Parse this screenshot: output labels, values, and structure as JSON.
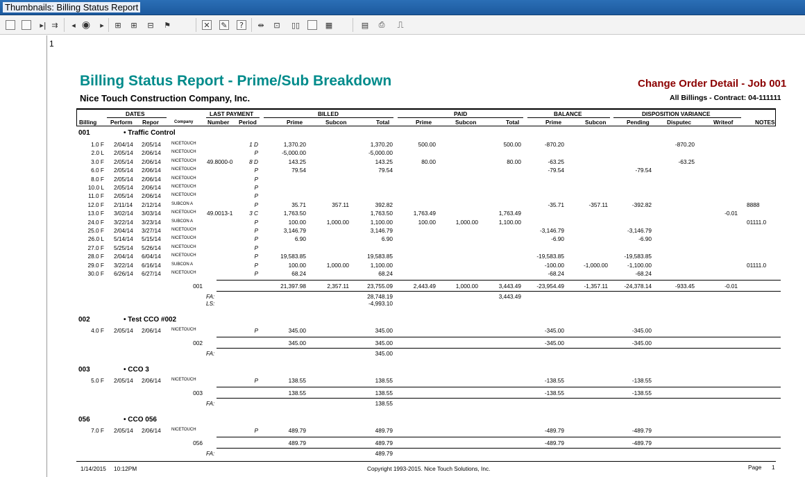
{
  "window": {
    "title": "Thumbnails: Billing Status Report"
  },
  "viewer": {
    "page_indicator": "1"
  },
  "report": {
    "title": "Billing Status Report - Prime/Sub Breakdown",
    "company": "Nice Touch Construction Company, Inc.",
    "subtitle": "Change Order Detail - Job 001",
    "contract": "All Billings  - Contract: 04-111111",
    "group_headers": {
      "dates": "DATES",
      "last_payment": "LAST PAYMENT",
      "billed": "BILLED",
      "paid": "PAID",
      "balance": "BALANCE",
      "disposition": "DISPOSITION VARIANCE"
    },
    "col_headers": {
      "billing": "Billing",
      "perform": "Perform",
      "report": "Repor",
      "company": "Company",
      "number": "Number",
      "period": "Period",
      "billed_prime": "Prime",
      "billed_subcon": "Subcon",
      "billed_total": "Total",
      "paid_prime": "Prime",
      "paid_subcon": "Subcon",
      "paid_total": "Total",
      "bal_prime": "Prime",
      "bal_subcon": "Subcon",
      "pending": "Pending",
      "disputed": "Disputec",
      "writeoff": "Writeof",
      "notes": "NOTES"
    },
    "footer": {
      "date": "1/14/2015",
      "time": "10:12PM",
      "copyright": "Copyright 1993-2015. Nice Touch Solutions, Inc.",
      "page_label": "Page",
      "page_number": "1"
    },
    "groups": [
      {
        "code": "001",
        "name": "• Traffic Control",
        "rows": [
          {
            "bill": "1.0 F",
            "perf": "2/04/14",
            "rep": "2/05/14",
            "co": "NICETOUCH",
            "num": "",
            "per": "1 D",
            "bp": "1,370.20",
            "bs": "",
            "bt": "1,370.20",
            "pp": "500.00",
            "ps": "",
            "pt": "500.00",
            "balp": "-870.20",
            "bals": "",
            "pend": "",
            "disp": "-870.20",
            "wo": "",
            "notes": ""
          },
          {
            "bill": "2.0 L",
            "perf": "2/05/14",
            "rep": "2/06/14",
            "co": "NICETOUCH",
            "num": "",
            "per": "P",
            "bp": "-5,000.00",
            "bs": "",
            "bt": "-5,000.00",
            "pp": "",
            "ps": "",
            "pt": "",
            "balp": "",
            "bals": "",
            "pend": "",
            "disp": "",
            "wo": "",
            "notes": ""
          },
          {
            "bill": "3.0 F",
            "perf": "2/05/14",
            "rep": "2/06/14",
            "co": "NICETOUCH",
            "num": "49.8000-0",
            "per": "8 D",
            "bp": "143.25",
            "bs": "",
            "bt": "143.25",
            "pp": "80.00",
            "ps": "",
            "pt": "80.00",
            "balp": "-63.25",
            "bals": "",
            "pend": "",
            "disp": "-63.25",
            "wo": "",
            "notes": ""
          },
          {
            "bill": "6.0 F",
            "perf": "2/05/14",
            "rep": "2/06/14",
            "co": "NICETOUCH",
            "num": "",
            "per": "P",
            "bp": "79.54",
            "bs": "",
            "bt": "79.54",
            "pp": "",
            "ps": "",
            "pt": "",
            "balp": "-79.54",
            "bals": "",
            "pend": "-79.54",
            "disp": "",
            "wo": "",
            "notes": ""
          },
          {
            "bill": "8.0 F",
            "perf": "2/05/14",
            "rep": "2/06/14",
            "co": "NICETOUCH",
            "num": "",
            "per": "P",
            "bp": "",
            "bs": "",
            "bt": "",
            "pp": "",
            "ps": "",
            "pt": "",
            "balp": "",
            "bals": "",
            "pend": "",
            "disp": "",
            "wo": "",
            "notes": ""
          },
          {
            "bill": "10.0 L",
            "perf": "2/05/14",
            "rep": "2/06/14",
            "co": "NICETOUCH",
            "num": "",
            "per": "P",
            "bp": "",
            "bs": "",
            "bt": "",
            "pp": "",
            "ps": "",
            "pt": "",
            "balp": "",
            "bals": "",
            "pend": "",
            "disp": "",
            "wo": "",
            "notes": ""
          },
          {
            "bill": "11.0 F",
            "perf": "2/05/14",
            "rep": "2/06/14",
            "co": "NICETOUCH",
            "num": "",
            "per": "P",
            "bp": "",
            "bs": "",
            "bt": "",
            "pp": "",
            "ps": "",
            "pt": "",
            "balp": "",
            "bals": "",
            "pend": "",
            "disp": "",
            "wo": "",
            "notes": ""
          },
          {
            "bill": "12.0 F",
            "perf": "2/11/14",
            "rep": "2/12/14",
            "co": "SUBCON A",
            "num": "",
            "per": "P",
            "bp": "35.71",
            "bs": "357.11",
            "bt": "392.82",
            "pp": "",
            "ps": "",
            "pt": "",
            "balp": "-35.71",
            "bals": "-357.11",
            "pend": "-392.82",
            "disp": "",
            "wo": "",
            "notes": "8888"
          },
          {
            "bill": "13.0 F",
            "perf": "3/02/14",
            "rep": "3/03/14",
            "co": "NICETOUCH",
            "num": "49.0013-1",
            "per": "3 C",
            "bp": "1,763.50",
            "bs": "",
            "bt": "1,763.50",
            "pp": "1,763.49",
            "ps": "",
            "pt": "1,763.49",
            "balp": "",
            "bals": "",
            "pend": "",
            "disp": "",
            "wo": "-0.01",
            "notes": ""
          },
          {
            "bill": "24.0 F",
            "perf": "3/22/14",
            "rep": "3/23/14",
            "co": "SUBCON A",
            "num": "",
            "per": "P",
            "bp": "100.00",
            "bs": "1,000.00",
            "bt": "1,100.00",
            "pp": "100.00",
            "ps": "1,000.00",
            "pt": "1,100.00",
            "balp": "",
            "bals": "",
            "pend": "",
            "disp": "",
            "wo": "",
            "notes": "01111.0"
          },
          {
            "bill": "25.0 F",
            "perf": "2/04/14",
            "rep": "3/27/14",
            "co": "NICETOUCH",
            "num": "",
            "per": "P",
            "bp": "3,146.79",
            "bs": "",
            "bt": "3,146.79",
            "pp": "",
            "ps": "",
            "pt": "",
            "balp": "-3,146.79",
            "bals": "",
            "pend": "-3,146.79",
            "disp": "",
            "wo": "",
            "notes": ""
          },
          {
            "bill": "26.0 L",
            "perf": "5/14/14",
            "rep": "5/15/14",
            "co": "NICETOUCH",
            "num": "",
            "per": "P",
            "bp": "6.90",
            "bs": "",
            "bt": "6.90",
            "pp": "",
            "ps": "",
            "pt": "",
            "balp": "-6.90",
            "bals": "",
            "pend": "-6.90",
            "disp": "",
            "wo": "",
            "notes": ""
          },
          {
            "bill": "27.0 F",
            "perf": "5/25/14",
            "rep": "5/26/14",
            "co": "NICETOUCH",
            "num": "",
            "per": "P",
            "bp": "",
            "bs": "",
            "bt": "",
            "pp": "",
            "ps": "",
            "pt": "",
            "balp": "",
            "bals": "",
            "pend": "",
            "disp": "",
            "wo": "",
            "notes": ""
          },
          {
            "bill": "28.0 F",
            "perf": "2/04/14",
            "rep": "6/04/14",
            "co": "NICETOUCH",
            "num": "",
            "per": "P",
            "bp": "19,583.85",
            "bs": "",
            "bt": "19,583.85",
            "pp": "",
            "ps": "",
            "pt": "",
            "balp": "-19,583.85",
            "bals": "",
            "pend": "-19,583.85",
            "disp": "",
            "wo": "",
            "notes": ""
          },
          {
            "bill": "29.0 F",
            "perf": "3/22/14",
            "rep": "6/16/14",
            "co": "SUBCON A",
            "num": "",
            "per": "P",
            "bp": "100.00",
            "bs": "1,000.00",
            "bt": "1,100.00",
            "pp": "",
            "ps": "",
            "pt": "",
            "balp": "-100.00",
            "bals": "-1,000.00",
            "pend": "-1,100.00",
            "disp": "",
            "wo": "",
            "notes": "01111.0"
          },
          {
            "bill": "30.0 F",
            "perf": "6/26/14",
            "rep": "6/27/14",
            "co": "NICETOUCH",
            "num": "",
            "per": "P",
            "bp": "68.24",
            "bs": "",
            "bt": "68.24",
            "pp": "",
            "ps": "",
            "pt": "",
            "balp": "-68.24",
            "bals": "",
            "pend": "-68.24",
            "disp": "",
            "wo": "",
            "notes": ""
          }
        ],
        "total": {
          "label": "001",
          "bp": "21,397.98",
          "bs": "2,357.11",
          "bt": "23,755.09",
          "pp": "2,443.49",
          "ps": "1,000.00",
          "pt": "3,443.49",
          "balp": "-23,954.49",
          "bals": "-1,357.11",
          "pend": "-24,378.14",
          "disp": "-933.45",
          "wo": "-0.01"
        },
        "extras": [
          {
            "label": "FA:",
            "bt": "28,748.19",
            "pt": "3,443.49"
          },
          {
            "label": "LS:",
            "bt": "-4,993.10",
            "pt": ""
          }
        ]
      },
      {
        "code": "002",
        "name": "• Test CCO #002",
        "rows": [
          {
            "bill": "4.0 F",
            "perf": "2/05/14",
            "rep": "2/06/14",
            "co": "NICETOUCH",
            "num": "",
            "per": "P",
            "bp": "345.00",
            "bs": "",
            "bt": "345.00",
            "pp": "",
            "ps": "",
            "pt": "",
            "balp": "-345.00",
            "bals": "",
            "pend": "-345.00",
            "disp": "",
            "wo": "",
            "notes": ""
          }
        ],
        "total": {
          "label": "002",
          "bp": "345.00",
          "bs": "",
          "bt": "345.00",
          "pp": "",
          "ps": "",
          "pt": "",
          "balp": "-345.00",
          "bals": "",
          "pend": "-345.00",
          "disp": "",
          "wo": ""
        },
        "extras": [
          {
            "label": "FA:",
            "bt": "345.00",
            "pt": ""
          }
        ]
      },
      {
        "code": "003",
        "name": "• CCO 3",
        "rows": [
          {
            "bill": "5.0 F",
            "perf": "2/05/14",
            "rep": "2/06/14",
            "co": "NICETOUCH",
            "num": "",
            "per": "P",
            "bp": "138.55",
            "bs": "",
            "bt": "138.55",
            "pp": "",
            "ps": "",
            "pt": "",
            "balp": "-138.55",
            "bals": "",
            "pend": "-138.55",
            "disp": "",
            "wo": "",
            "notes": ""
          }
        ],
        "total": {
          "label": "003",
          "bp": "138.55",
          "bs": "",
          "bt": "138.55",
          "pp": "",
          "ps": "",
          "pt": "",
          "balp": "-138.55",
          "bals": "",
          "pend": "-138.55",
          "disp": "",
          "wo": ""
        },
        "extras": [
          {
            "label": "FA:",
            "bt": "138.55",
            "pt": ""
          }
        ]
      },
      {
        "code": "056",
        "name": "• CCO 056",
        "rows": [
          {
            "bill": "7.0 F",
            "perf": "2/05/14",
            "rep": "2/06/14",
            "co": "NICETOUCH",
            "num": "",
            "per": "P",
            "bp": "489.79",
            "bs": "",
            "bt": "489.79",
            "pp": "",
            "ps": "",
            "pt": "",
            "balp": "-489.79",
            "bals": "",
            "pend": "-489.79",
            "disp": "",
            "wo": "",
            "notes": ""
          }
        ],
        "total": {
          "label": "056",
          "bp": "489.79",
          "bs": "",
          "bt": "489.79",
          "pp": "",
          "ps": "",
          "pt": "",
          "balp": "-489.79",
          "bals": "",
          "pend": "-489.79",
          "disp": "",
          "wo": ""
        },
        "extras": [
          {
            "label": "FA:",
            "bt": "489.79",
            "pt": ""
          }
        ]
      }
    ]
  },
  "toolbar": {
    "icons": [
      "first-page-icon",
      "blank-page-icon",
      "next-end-icon",
      "export-icon",
      "prev-icon",
      "eye-icon",
      "next-icon",
      "group-tree-icon",
      "group-add-icon",
      "group-remove-icon",
      "flag-icon",
      "close-icon",
      "edit-icon",
      "help-icon",
      "fit-width-icon",
      "fit-page-icon",
      "two-page-icon",
      "single-page-icon",
      "thumbnails-icon",
      "print-setup-icon",
      "print-icon",
      "exit-icon"
    ]
  }
}
